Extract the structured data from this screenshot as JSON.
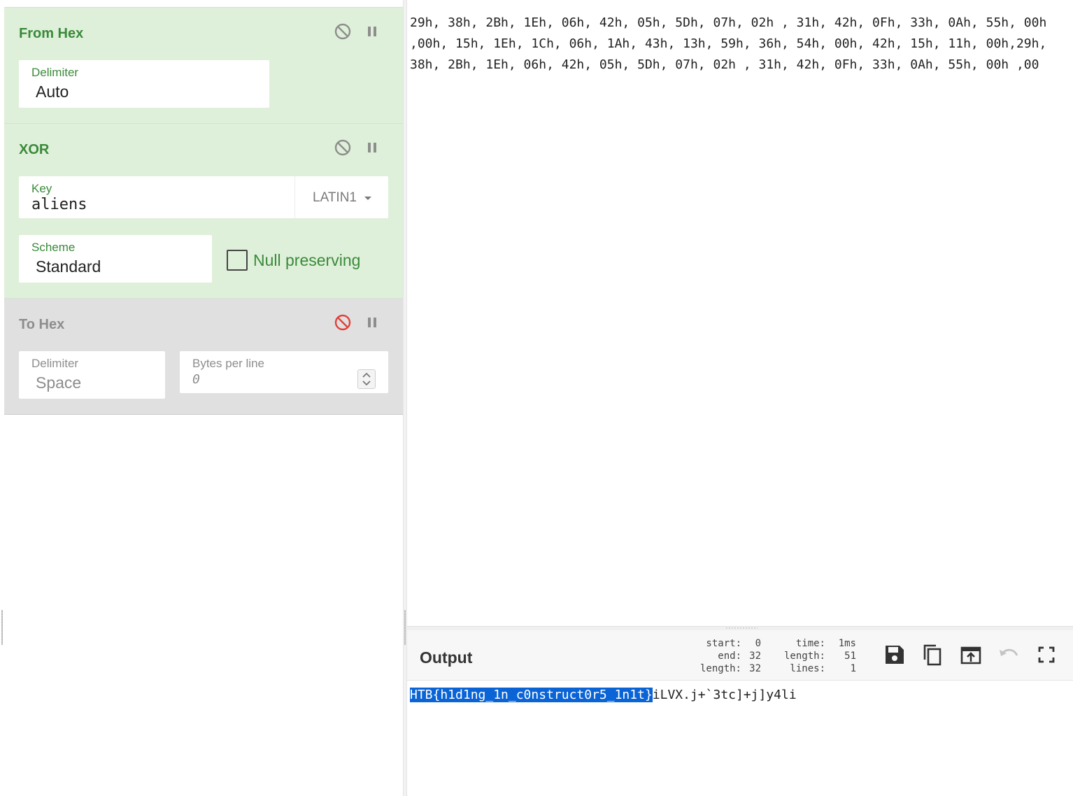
{
  "recipe": {
    "operations": [
      {
        "title": "From Hex",
        "state": "active",
        "fields": {
          "delimiter_label": "Delimiter",
          "delimiter_value": "Auto"
        }
      },
      {
        "title": "XOR",
        "state": "active",
        "fields": {
          "key_label": "Key",
          "key_value": "aliens",
          "key_encoding": "LATIN1",
          "scheme_label": "Scheme",
          "scheme_value": "Standard",
          "null_preserving_label": "Null preserving",
          "null_preserving_checked": false
        }
      },
      {
        "title": "To Hex",
        "state": "disabled",
        "fields": {
          "delimiter_label": "Delimiter",
          "delimiter_value": "Space",
          "bytes_per_line_label": "Bytes per line",
          "bytes_per_line_value": "0"
        }
      }
    ],
    "icons": [
      "disable-icon",
      "pause-icon"
    ]
  },
  "input": {
    "text": "29h, 38h, 2Bh, 1Eh, 06h, 42h, 05h, 5Dh, 07h, 02h , 31h, 42h, 0Fh, 33h, 0Ah, 55h, 00h ,00h, 15h, 1Eh, 1Ch, 06h, 1Ah, 43h, 13h, 59h, 36h, 54h, 00h, 42h, 15h, 11h, 00h,29h, 38h, 2Bh, 1Eh, 06h, 42h, 05h, 5Dh, 07h, 02h , 31h, 42h, 0Fh, 33h, 0Ah, 55h, 00h ,00"
  },
  "output": {
    "title": "Output",
    "stats": {
      "start_label": "start:",
      "start_value": "0",
      "end_label": "end:",
      "end_value": "32",
      "sel_length_label": "length:",
      "sel_length_value": "32",
      "time_label": "time:",
      "time_value": "1ms",
      "length_label": "length:",
      "length_value": "51",
      "lines_label": "lines:",
      "lines_value": "1"
    },
    "toolbar_icons": [
      "save-icon",
      "copy-icon",
      "replace-input-icon",
      "undo-icon",
      "maximise-icon"
    ],
    "highlighted_text": "HTB{h1d1ng_1n_c0nstruct0r5_1n1t}",
    "rest_text": "iLVX.j+`3tc]+j]y4li"
  },
  "colors": {
    "active_bg": "#dff0da",
    "active_title": "#3a8a3a",
    "disabled_bg": "#e0e0e0",
    "disabled_icon_red": "#e0413a",
    "selection": "#0a64d6"
  }
}
